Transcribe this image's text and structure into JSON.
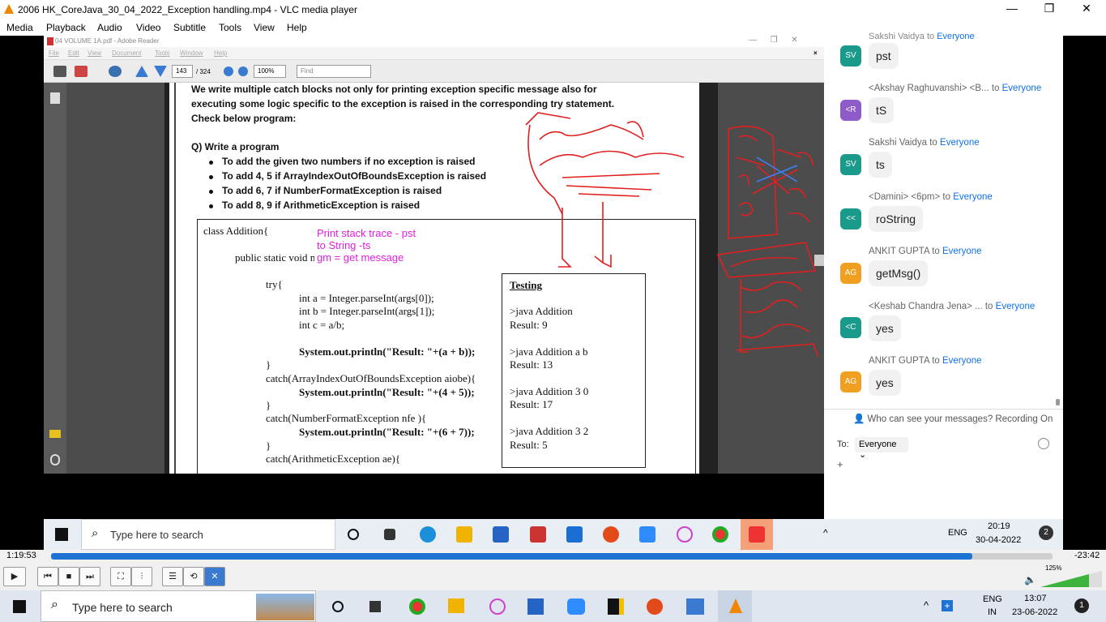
{
  "window": {
    "title": "2006 HK_CoreJava_30_04_2022_Exception handling.mp4 - VLC media player",
    "controls": [
      "—",
      "❐",
      "✕"
    ]
  },
  "menu": [
    "Media",
    "Playback",
    "Audio",
    "Video",
    "Subtitle",
    "Tools",
    "View",
    "Help"
  ],
  "reader": {
    "title": "04 VOLUME 1A.pdf - Adobe Reader",
    "menu": [
      "File",
      "Edit",
      "View",
      "Document",
      "Tools",
      "Window",
      "Help"
    ],
    "page_current": "143",
    "page_total": "/ 324",
    "zoom": "100%",
    "find_placeholder": "Find"
  },
  "document": {
    "intro1": "We write multiple catch blocks not only for printing exception specific message also for",
    "intro2": "executing some logic specific to the exception is raised in the corresponding try statement.",
    "intro3": "Check below program:",
    "question": "Q) Write a program",
    "bullets": [
      "To add the given two numbers if no exception is raised",
      "To add 4, 5 if ArrayIndexOutOfBoundsException is raised",
      "To add 6, 7 if NumberFormatException is raised",
      "To add 8, 9 if ArithmeticException is raised"
    ],
    "code": [
      "class Addition{",
      "public static void main(String[] args){",
      "try{",
      "int a = Integer.parseInt(args[0]);",
      "int b = Integer.parseInt(args[1]);",
      "int c = a/b;",
      "System.out.println(\"Result: \"+(a + b));",
      "}",
      "catch(ArrayIndexOutOfBoundsException aiobe){",
      "System.out.println(\"Result: \"+(4 + 5));",
      "}",
      "catch(NumberFormatException nfe ){",
      "System.out.println(\"Result: \"+(6 + 7));",
      "}",
      "catch(ArithmeticException ae){"
    ],
    "testing_title": "Testing",
    "testing": [
      ">java Addition",
      "Result: 9",
      ">java Addition a b",
      "Result: 13",
      ">java Addition 3 0",
      "Result: 17",
      ">java Addition 3 2",
      "Result: 5"
    ],
    "pink_notes": [
      "Print stack trace - pst",
      "to String -ts",
      "gm = get message"
    ]
  },
  "chat": {
    "messages": [
      {
        "initials": "SV",
        "color": "#1a9a8a",
        "from": "Sakshi Vaidya",
        "to": "Everyone",
        "text": "pst"
      },
      {
        "initials": "<R",
        "color": "#8e5bc8",
        "from": "<Akshay Raghuvanshi> <B...",
        "to": "Everyone",
        "text": "tS"
      },
      {
        "initials": "SV",
        "color": "#1a9a8a",
        "from": "Sakshi Vaidya",
        "to": "Everyone",
        "text": "ts"
      },
      {
        "initials": "<<",
        "color": "#1a9a8a",
        "from": "<Damini> <6pm>",
        "to": "Everyone",
        "text": "roString"
      },
      {
        "initials": "AG",
        "color": "#f0a020",
        "from": "ANKIT GUPTA",
        "to": "Everyone",
        "text": "getMsg()"
      },
      {
        "initials": "<C",
        "color": "#1a9a8a",
        "from": "<Keshab Chandra Jena> ...",
        "to": "Everyone",
        "text": "yes"
      },
      {
        "initials": "AG",
        "color": "#f0a020",
        "from": "ANKIT GUPTA",
        "to": "Everyone",
        "text": "yes"
      }
    ],
    "to_word": "to",
    "visibility_note": "Who can see your messages? Recording On",
    "to_label": "To:",
    "recipient": "Everyone",
    "plus": "+"
  },
  "inner_taskbar": {
    "search_placeholder": "Type here to search",
    "lang": "ENG",
    "time": "20:19",
    "date": "30-04-2022",
    "notif": "2"
  },
  "player": {
    "elapsed": "1:19:53",
    "remaining": "-23:42",
    "progress": 0.92,
    "volume": "125%"
  },
  "taskbar": {
    "search_placeholder": "Type here to search",
    "lang": "ENG",
    "region": "IN",
    "time": "13:07",
    "date": "23-06-2022",
    "notif": "1"
  }
}
